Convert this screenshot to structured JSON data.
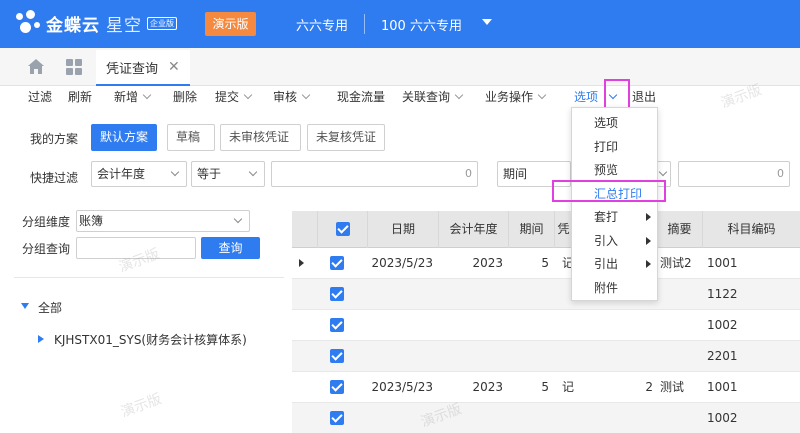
{
  "header": {
    "brand": "金蝶云",
    "product": "星空",
    "edition": "企业版",
    "demo_label": "演示版",
    "org1": "六六专用",
    "org2": "100 六六专用"
  },
  "tabs": {
    "active_label": "凭证查询",
    "close_glyph": "✕"
  },
  "toolbar": {
    "filter": "过滤",
    "refresh": "刷新",
    "new": "新增",
    "delete": "删除",
    "submit": "提交",
    "audit": "审核",
    "cashflow": "现金流量",
    "related": "关联查询",
    "business": "业务操作",
    "options": "选项",
    "exit": "退出"
  },
  "filters": {
    "my_scheme_label": "我的方案",
    "schemes": [
      "默认方案",
      "草稿",
      "未审核凭证",
      "未复核凭证"
    ],
    "quick_filter_label": "快捷过滤",
    "field1": "会计年度",
    "operator1": "等于",
    "value1_placeholder": "0",
    "field2": "期间",
    "value2_placeholder": "0"
  },
  "left_panel": {
    "group_dim_label": "分组维度",
    "group_dim_value": "账簿",
    "group_query_label": "分组查询",
    "query_button": "查询",
    "tree_root": "全部",
    "tree_child": "KJHSTX01_SYS(财务会计核算体系)"
  },
  "grid": {
    "columns": [
      "日期",
      "会计年度",
      "期间",
      "凭",
      "摘要",
      "科目编码"
    ],
    "rows": [
      {
        "date": "2023/5/23",
        "year": "2023",
        "period": "5",
        "word": "记",
        "no": "",
        "summary": "测试2",
        "account": "1001",
        "current": true
      },
      {
        "date": "",
        "year": "",
        "period": "",
        "word": "",
        "no": "",
        "summary": "",
        "account": "1122",
        "current": false
      },
      {
        "date": "",
        "year": "",
        "period": "",
        "word": "",
        "no": "",
        "summary": "",
        "account": "1002",
        "current": false
      },
      {
        "date": "",
        "year": "",
        "period": "",
        "word": "",
        "no": "",
        "summary": "",
        "account": "2201",
        "current": false
      },
      {
        "date": "2023/5/23",
        "year": "2023",
        "period": "5",
        "word": "记",
        "no": "2",
        "summary": "测试",
        "account": "1001",
        "current": false
      },
      {
        "date": "",
        "year": "",
        "period": "",
        "word": "",
        "no": "",
        "summary": "",
        "account": "1002",
        "current": false
      }
    ]
  },
  "options_menu": {
    "items": [
      {
        "label": "选项",
        "submenu": false
      },
      {
        "label": "打印",
        "submenu": false
      },
      {
        "label": "预览",
        "submenu": false
      },
      {
        "label": "汇总打印",
        "submenu": false,
        "highlighted": true
      },
      {
        "label": "套打",
        "submenu": true
      },
      {
        "label": "引入",
        "submenu": true
      },
      {
        "label": "引出",
        "submenu": true
      },
      {
        "label": "附件",
        "submenu": false
      }
    ]
  },
  "watermark": "演示版",
  "colors": {
    "primary": "#2f7cf0",
    "demo_orange": "#f5893f",
    "highlight_box": "#e040e0"
  }
}
